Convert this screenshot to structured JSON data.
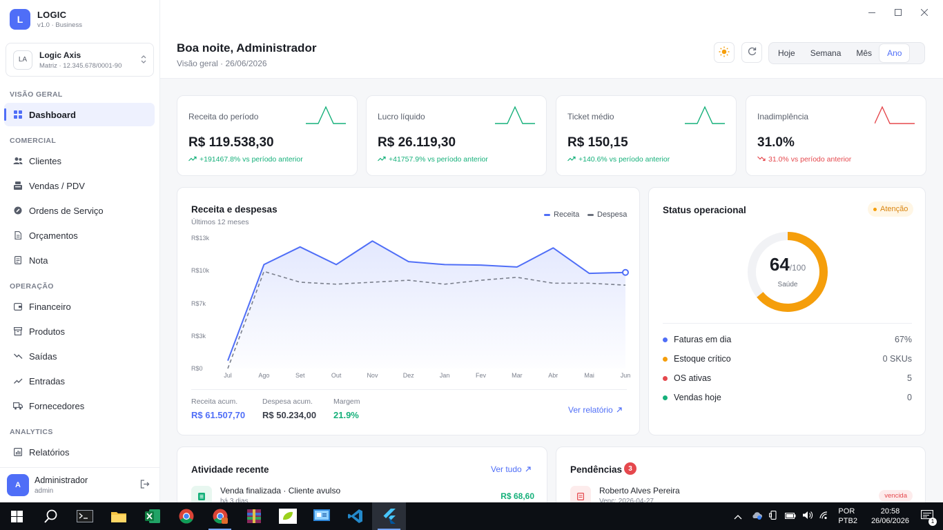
{
  "brand": {
    "logo_letter": "L",
    "name": "LOGIC",
    "version": "v1.0 · Business"
  },
  "company": {
    "badge": "LA",
    "name": "Logic Axis",
    "sub": "Matriz · 12.345.678/0001-90"
  },
  "nav": {
    "section_overview": "VISÃO GERAL",
    "dashboard": "Dashboard",
    "section_commercial": "COMERCIAL",
    "clientes": "Clientes",
    "vendas": "Vendas / PDV",
    "ordens": "Ordens de Serviço",
    "orcamentos": "Orçamentos",
    "nota": "Nota",
    "section_operation": "OPERAÇÃO",
    "financeiro": "Financeiro",
    "produtos": "Produtos",
    "saidas": "Saídas",
    "entradas": "Entradas",
    "fornecedores": "Fornecedores",
    "section_analytics": "ANALYTICS",
    "relatorios": "Relatórios"
  },
  "user": {
    "avatar": "A",
    "name": "Administrador",
    "role": "admin"
  },
  "header": {
    "greeting": "Boa noite, Administrador",
    "subtitle": "Visão geral · 26/06/2026",
    "periods": [
      "Hoje",
      "Semana",
      "Mês",
      "Ano"
    ],
    "active_period": "Ano"
  },
  "kpis": [
    {
      "label": "Receita do período",
      "value": "R$ 119.538,30",
      "delta": "+191467.8% vs período anterior",
      "trend": "up",
      "color": "#15b07a"
    },
    {
      "label": "Lucro líquido",
      "value": "R$ 26.119,30",
      "delta": "+41757.9% vs período anterior",
      "trend": "up",
      "color": "#15b07a"
    },
    {
      "label": "Ticket médio",
      "value": "R$ 150,15",
      "delta": "+140.6% vs período anterior",
      "trend": "up",
      "color": "#15b07a"
    },
    {
      "label": "Inadimplência",
      "value": "31.0%",
      "delta": "31.0% vs período anterior",
      "trend": "down",
      "color": "#e5484d"
    }
  ],
  "revenue_card": {
    "title": "Receita e despesas",
    "subtitle": "Últimos 12 meses",
    "legend_receita": "Receita",
    "legend_despesa": "Despesa",
    "stat1_label": "Receita acum.",
    "stat1_value": "R$ 61.507,70",
    "stat2_label": "Despesa acum.",
    "stat2_value": "R$ 50.234,00",
    "stat3_label": "Margem",
    "stat3_value": "21.9%",
    "report_link": "Ver relatório"
  },
  "chart_data": {
    "type": "area",
    "title": "Receita e despesas",
    "subtitle": "Últimos 12 meses",
    "categories": [
      "Jul",
      "Ago",
      "Set",
      "Out",
      "Nov",
      "Dez",
      "Jan",
      "Fev",
      "Mar",
      "Abr",
      "Mai",
      "Jun"
    ],
    "y_ticks": [
      "R$0",
      "R$3k",
      "R$7k",
      "R$10k",
      "R$13k"
    ],
    "ylim": [
      0,
      13300
    ],
    "series": [
      {
        "name": "Receita",
        "color": "#4f6ef7",
        "values": [
          800,
          10600,
          12400,
          10600,
          13000,
          10900,
          10600,
          10550,
          10350,
          12300,
          9700,
          9800
        ]
      },
      {
        "name": "Despesa",
        "color": "#7a7f8c",
        "values": [
          0,
          9900,
          8800,
          8600,
          8800,
          9000,
          8600,
          9000,
          9300,
          8700,
          8700,
          8500
        ]
      }
    ],
    "legend": "top-right",
    "grid": false
  },
  "status_card": {
    "title": "Status operacional",
    "badge": "Atenção",
    "score": "64",
    "score_max": "/100",
    "score_label": "Saúde",
    "score_fraction": 0.64,
    "rows": [
      {
        "label": "Faturas em dia",
        "value": "67%",
        "color": "#4f6ef7"
      },
      {
        "label": "Estoque crítico",
        "value": "0 SKUs",
        "color": "#f59e0b"
      },
      {
        "label": "OS ativas",
        "value": "5",
        "color": "#e5484d"
      },
      {
        "label": "Vendas hoje",
        "value": "0",
        "color": "#15b07a"
      }
    ]
  },
  "activity": {
    "title": "Atividade recente",
    "link": "Ver tudo",
    "item_title": "Venda finalizada · Cliente avulso",
    "item_sub": "há 3 dias",
    "item_value": "R$ 68,60"
  },
  "pending": {
    "title": "Pendências",
    "count": "3",
    "item_title": "Roberto Alves Pereira",
    "item_sub": "Venc: 2026-04-27",
    "item_badge": "vencida"
  },
  "taskbar": {
    "lang1": "POR",
    "lang2": "PTB2",
    "time": "20:58",
    "date": "26/06/2026",
    "notif_count": "1"
  }
}
